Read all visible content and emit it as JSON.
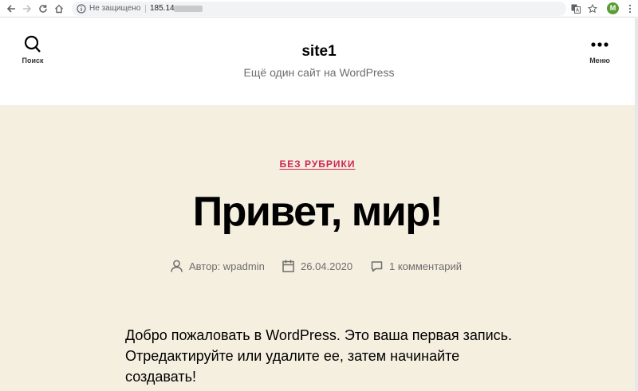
{
  "browser": {
    "security_status": "Не защищено",
    "url": "185.14",
    "profile_initial": "M"
  },
  "header": {
    "search_label": "Поиск",
    "site_title": "site1",
    "site_description": "Ещё один сайт на WordPress",
    "menu_label": "Меню"
  },
  "post": {
    "category": "БЕЗ РУБРИКИ",
    "title": "Привет, мир!",
    "author": "Автор: wpadmin",
    "date": "26.04.2020",
    "comments": "1 комментарий",
    "body": "Добро пожаловать в WordPress. Это ваша первая запись. Отредактируйте или удалите ее, затем начинайте создавать!"
  },
  "colors": {
    "accent": "#cd2653",
    "content_bg": "#f5efe0",
    "meta_text": "#6d6d6d"
  }
}
